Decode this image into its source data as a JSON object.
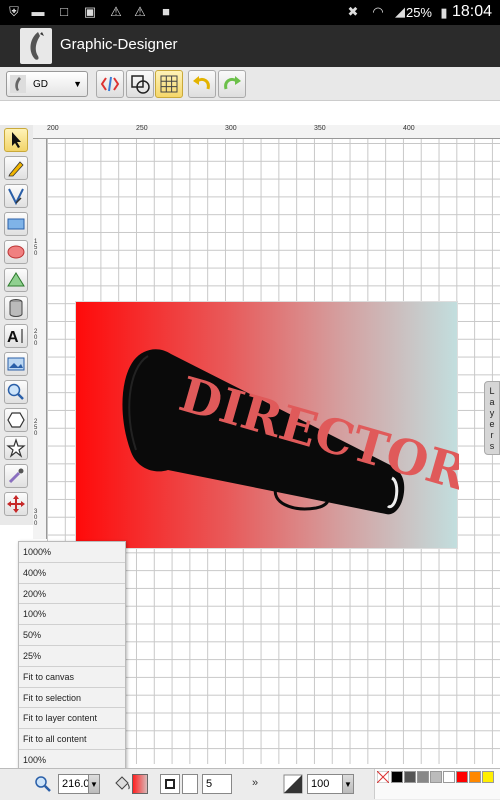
{
  "status_bar": {
    "battery": "25%",
    "time": "18:04"
  },
  "app": {
    "title": "Graphic-Designer"
  },
  "toolbar": {
    "layer_select": "GD"
  },
  "rulers": {
    "horizontal_ticks": [
      "200",
      "250",
      "300",
      "350",
      "400"
    ],
    "vertical_ticks": [
      "1 5 0",
      "2 0 0",
      "2 5 0",
      "3 0 0"
    ]
  },
  "artwork": {
    "text": "DIRECTOR"
  },
  "layers_tab": {
    "label_letters": [
      "L",
      "a",
      "y",
      "e",
      "r",
      "s"
    ]
  },
  "zoom_menu": {
    "items": [
      "1000%",
      "400%",
      "200%",
      "100%",
      "50%",
      "25%",
      "Fit to canvas",
      "Fit to selection",
      "Fit to layer content",
      "Fit to all content",
      "100%"
    ]
  },
  "bottom_bar": {
    "zoom_value": "216.0",
    "stroke_width": "5",
    "opacity": "100",
    "more_label": "»"
  },
  "palette": {
    "colors": [
      "#000000",
      "#555555",
      "#888888",
      "#bbbbbb",
      "#ffffff",
      "#ff0000",
      "#ff8800",
      "#ffee00"
    ]
  },
  "colors": {
    "accent_yellow": "#f5d76a",
    "artwork_red": "#ff0a0a",
    "artwork_teal": "#c2dede"
  }
}
